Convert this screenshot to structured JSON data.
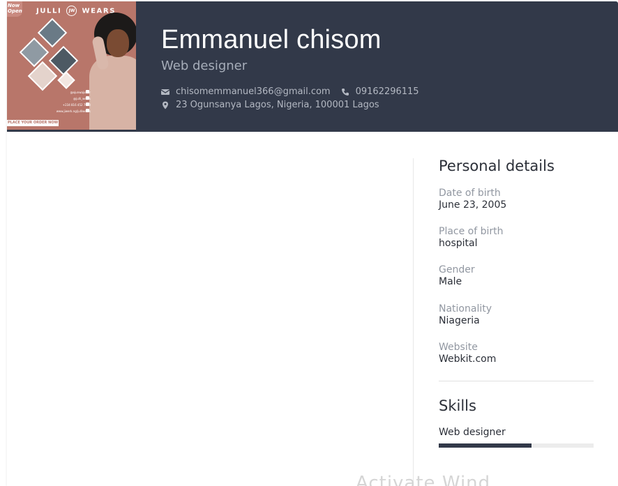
{
  "header": {
    "name": "Emmanuel chisom",
    "title": "Web designer",
    "email": "chisomemmanuel366@gmail.com",
    "phone": "09162296115",
    "address": "23 Ogunsanya Lagos, Nigeria, 100001 Lagos",
    "icons": {
      "email": "envelope-icon",
      "phone": "phone-icon",
      "address": "map-pin-icon"
    },
    "photo": {
      "badge": "Now Open",
      "brand_left": "JULLI",
      "brand_mono": "JW",
      "brand_right": "WEARS",
      "socials": [
        "@ojunwajullier",
        "@julli_wears",
        "+234 816 452 7960",
        "www.jiwerk.ng/julliwears"
      ],
      "cta": "PLACE YOUR ORDER NOW"
    }
  },
  "personal_details": {
    "heading": "Personal details",
    "items": [
      {
        "label": "Date of birth",
        "value": "June 23, 2005"
      },
      {
        "label": "Place of birth",
        "value": "hospital"
      },
      {
        "label": "Gender",
        "value": "Male"
      },
      {
        "label": "Nationality",
        "value": "Niageria"
      },
      {
        "label": "Website",
        "value": "Webkit.com"
      }
    ]
  },
  "skills": {
    "heading": "Skills",
    "items": [
      {
        "name": "Web designer",
        "level": 0.6
      }
    ]
  },
  "watermark": "Activate Wind",
  "colors": {
    "header_bg": "#323949",
    "accent": "#323949",
    "muted": "#9197a1"
  }
}
